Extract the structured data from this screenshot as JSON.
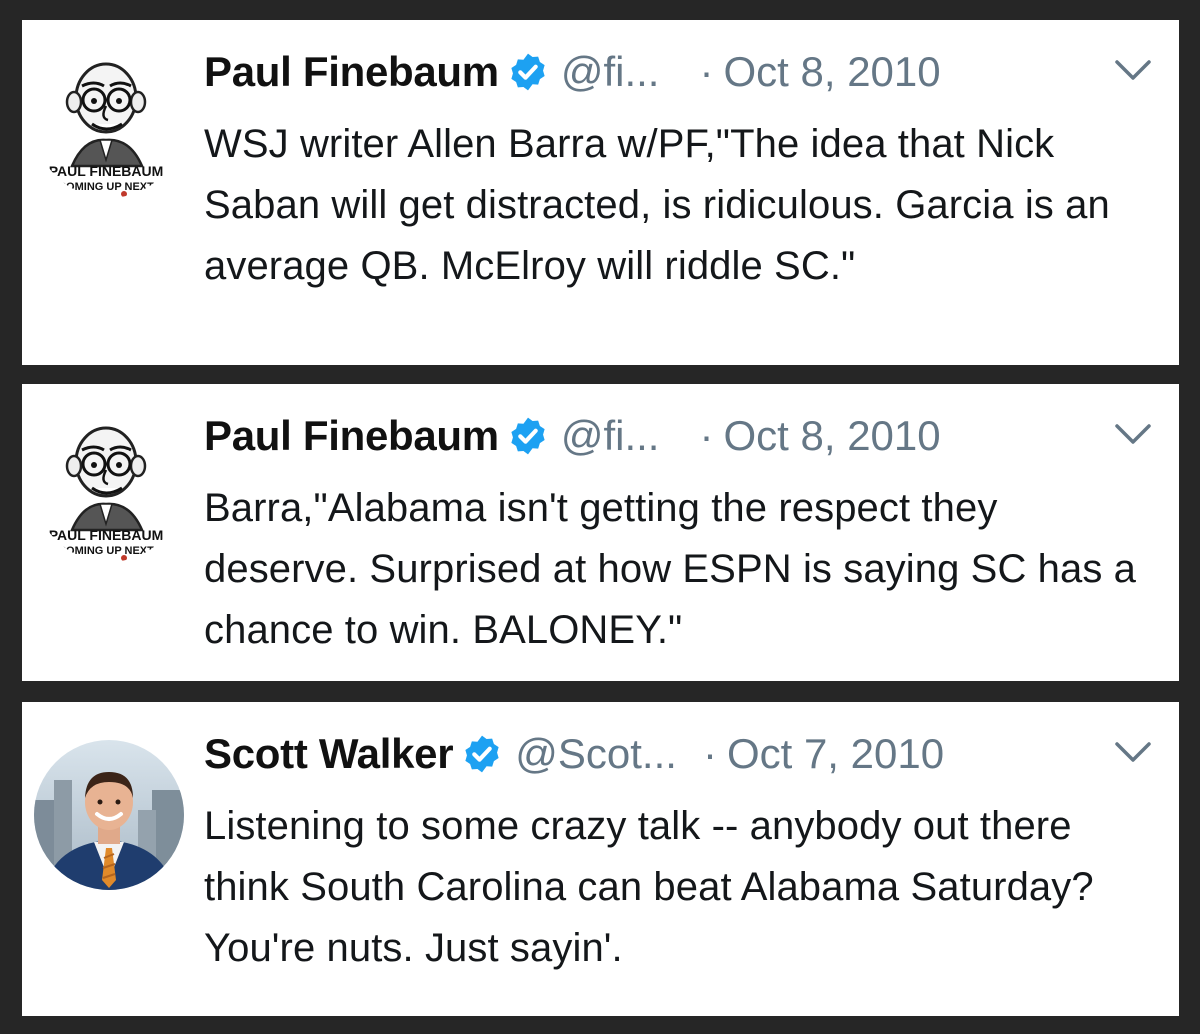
{
  "tweets": [
    {
      "author": "Paul Finebaum",
      "handle": "@fi...",
      "separator": "·",
      "date": "Oct 8, 2010",
      "avatar_caption_1": "PAUL FINEBAUM",
      "avatar_caption_2": "COMING UP NEXT",
      "text": "WSJ writer Allen Barra w/PF,\"The idea that Nick Saban will get distracted, is ridiculous. Garcia is an average QB. McElroy will riddle SC.\""
    },
    {
      "author": "Paul Finebaum",
      "handle": "@fi...",
      "separator": "·",
      "date": "Oct 8, 2010",
      "avatar_caption_1": "PAUL FINEBAUM",
      "avatar_caption_2": "COMING UP NEXT",
      "text": "Barra,\"Alabama isn't getting the respect they deserve. Surprised at how ESPN is saying SC has a chance to win. BALONEY.\""
    },
    {
      "author": "Scott Walker",
      "handle": "@Scot...",
      "separator": "·",
      "date": "Oct 7, 2010",
      "text": "Listening to some crazy talk -- anybody out there think South Carolina can beat Alabama Saturday? You're nuts. Just sayin'."
    }
  ],
  "icons": {
    "verified": "verified-badge-icon",
    "menu": "chevron-down-icon"
  },
  "colors": {
    "background": "#262626",
    "card": "#ffffff",
    "verified_blue": "#1da1f2",
    "muted_text": "#657786",
    "primary_text": "#14171a"
  }
}
